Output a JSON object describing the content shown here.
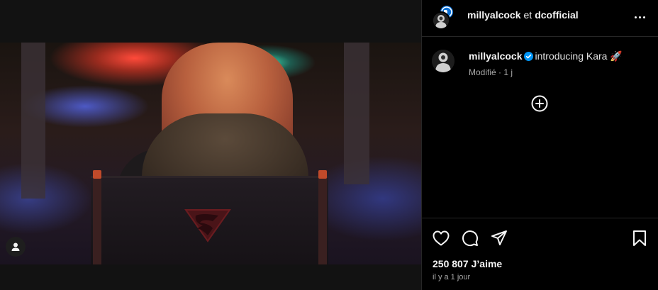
{
  "post": {
    "header": {
      "author1": "millyalcock",
      "joiner": "et",
      "author2": "dcofficial"
    },
    "caption": {
      "username": "millyalcock",
      "text": "introducing Kara",
      "emoji": "🚀",
      "meta": "Modifié · 1 j"
    },
    "likes_count": "250 807",
    "likes_word": "J’aime",
    "timestamp": "il y a 1 jour"
  },
  "icons": {
    "more": "more-horizontal-icon",
    "verified": "verified-badge-icon",
    "add": "add-circle-icon",
    "like": "heart-icon",
    "comment": "comment-icon",
    "share": "send-icon",
    "save": "bookmark-icon",
    "user_tag": "user-tag-icon"
  },
  "colors": {
    "verified": "#0095f6",
    "background": "#000000",
    "muted_text": "#a8a8a8"
  }
}
